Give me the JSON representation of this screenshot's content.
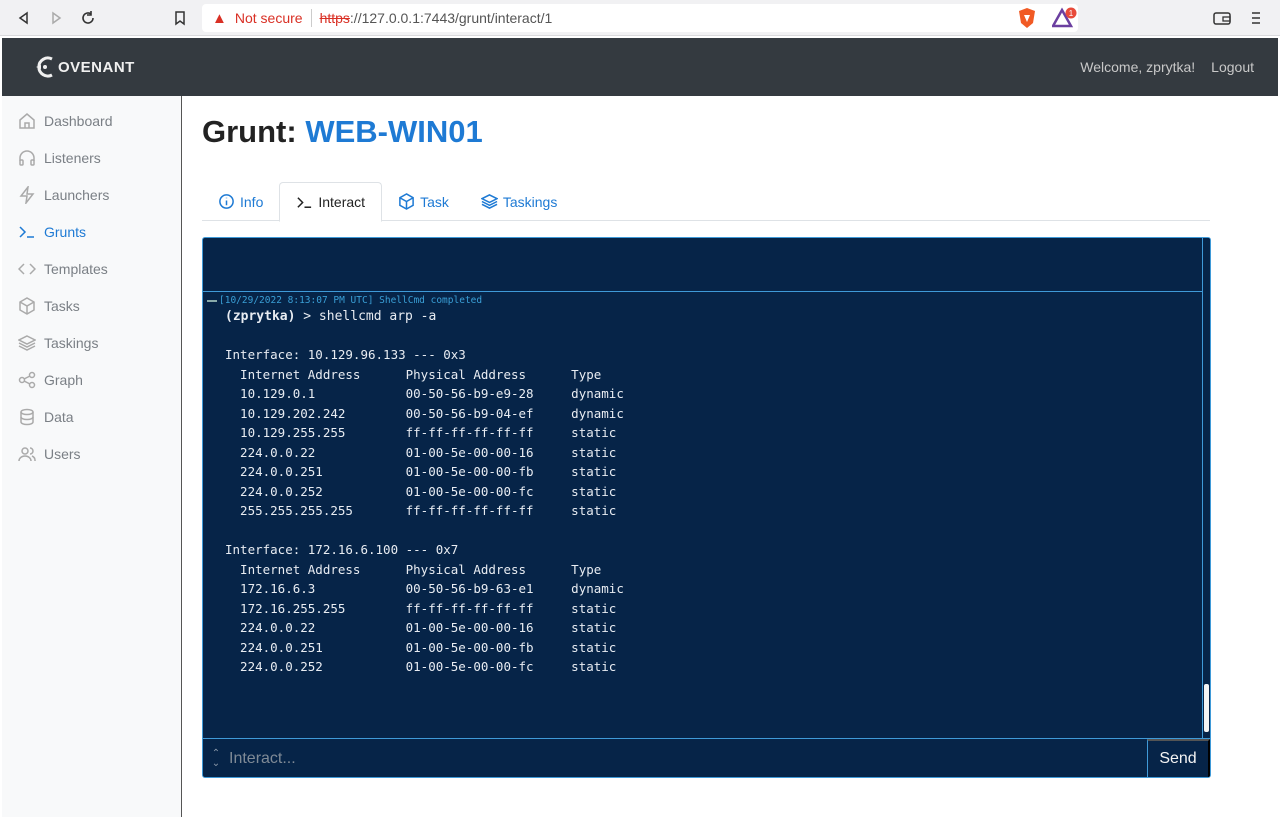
{
  "browser": {
    "security_label": "Not secure",
    "url_scheme": "https",
    "url_rest": "://127.0.0.1:7443/grunt/interact/1",
    "notification_count": "1"
  },
  "header": {
    "logo_text": "OVENANT",
    "welcome": "Welcome, zprytka!",
    "logout": "Logout"
  },
  "sidebar": {
    "items": [
      {
        "label": "Dashboard"
      },
      {
        "label": "Listeners"
      },
      {
        "label": "Launchers"
      },
      {
        "label": "Grunts"
      },
      {
        "label": "Templates"
      },
      {
        "label": "Tasks"
      },
      {
        "label": "Taskings"
      },
      {
        "label": "Graph"
      },
      {
        "label": "Data"
      },
      {
        "label": "Users"
      }
    ],
    "active": "Grunts"
  },
  "page": {
    "title_prefix": "Grunt:",
    "grunt_name": "WEB-WIN01"
  },
  "tabs": [
    {
      "label": "Info"
    },
    {
      "label": "Interact"
    },
    {
      "label": "Task"
    },
    {
      "label": "Taskings"
    }
  ],
  "terminal": {
    "meta": "[10/29/2022 8:13:07 PM UTC] ShellCmd completed",
    "user": "(zprytka)",
    "command": " > shellcmd arp -a",
    "output": "Interface: 10.129.96.133 --- 0x3\n  Internet Address      Physical Address      Type\n  10.129.0.1            00-50-56-b9-e9-28     dynamic\n  10.129.202.242        00-50-56-b9-04-ef     dynamic\n  10.129.255.255        ff-ff-ff-ff-ff-ff     static\n  224.0.0.22            01-00-5e-00-00-16     static\n  224.0.0.251           01-00-5e-00-00-fb     static\n  224.0.0.252           01-00-5e-00-00-fc     static\n  255.255.255.255       ff-ff-ff-ff-ff-ff     static\n\nInterface: 172.16.6.100 --- 0x7\n  Internet Address      Physical Address      Type\n  172.16.6.3            00-50-56-b9-63-e1     dynamic\n  172.16.255.255        ff-ff-ff-ff-ff-ff     static\n  224.0.0.22            01-00-5e-00-00-16     static\n  224.0.0.251           01-00-5e-00-00-fb     static\n  224.0.0.252           01-00-5e-00-00-fc     static",
    "input_placeholder": "Interact...",
    "send_label": "Send"
  }
}
